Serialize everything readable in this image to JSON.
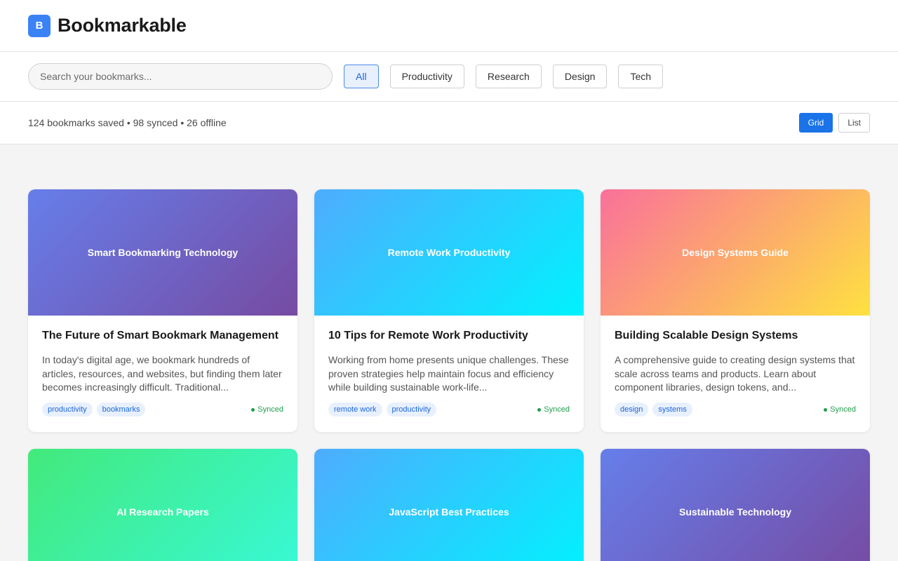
{
  "app": {
    "logo_letter": "B",
    "title": "Bookmarkable"
  },
  "search": {
    "placeholder": "Search your bookmarks..."
  },
  "filters": [
    "All",
    "Productivity",
    "Research",
    "Design",
    "Tech"
  ],
  "active_filter": "All",
  "stats": {
    "text": "124 bookmarks saved • 98 synced • 26 offline"
  },
  "view": {
    "grid_label": "Grid",
    "list_label": "List",
    "active": "Grid"
  },
  "colors": {
    "accent": "#1a73e8",
    "synced": "#1e9e4a",
    "logo": "#3b82f6"
  },
  "cards": [
    {
      "thumb_label": "Smart Bookmarking Technology",
      "title": "The Future of Smart Bookmark Management",
      "excerpt": "In today's digital age, we bookmark hundreds of articles, resources, and websites, but finding them later becomes increasingly difficult. Traditional...",
      "tags": [
        "productivity",
        "bookmarks"
      ],
      "status": "Synced"
    },
    {
      "thumb_label": "Remote Work Productivity",
      "title": "10 Tips for Remote Work Productivity",
      "excerpt": "Working from home presents unique challenges. These proven strategies help maintain focus and efficiency while building sustainable work-life...",
      "tags": [
        "remote work",
        "productivity"
      ],
      "status": "Synced"
    },
    {
      "thumb_label": "Design Systems Guide",
      "title": "Building Scalable Design Systems",
      "excerpt": "A comprehensive guide to creating design systems that scale across teams and products. Learn about component libraries, design tokens, and...",
      "tags": [
        "design",
        "systems"
      ],
      "status": "Synced"
    },
    {
      "thumb_label": "AI Research Papers"
    },
    {
      "thumb_label": "JavaScript Best Practices"
    },
    {
      "thumb_label": "Sustainable Technology"
    }
  ]
}
